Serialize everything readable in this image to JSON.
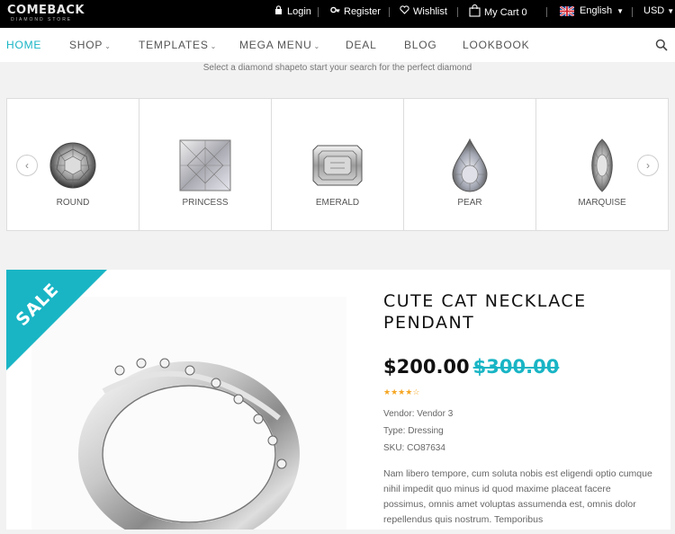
{
  "header": {
    "logo_text": "COMEBACK",
    "logo_sub": "DIAMOND STORE",
    "login_label": "Login",
    "register_label": "Register",
    "wishlist_label": "Wishlist",
    "cart_label": "My Cart 0",
    "language": "English",
    "currency": "USD"
  },
  "nav": {
    "items": [
      {
        "label": "HOME"
      },
      {
        "label": "SHOP"
      },
      {
        "label": "TEMPLATES"
      },
      {
        "label": "MEGA MENU"
      },
      {
        "label": "DEAL"
      },
      {
        "label": "BLOG"
      },
      {
        "label": "LOOKBOOK"
      }
    ]
  },
  "shapes": {
    "hint": "Select a diamond shapeto start your search for the perfect diamond",
    "items": [
      {
        "label": "ROUND"
      },
      {
        "label": "PRINCESS"
      },
      {
        "label": "EMERALD"
      },
      {
        "label": "PEAR"
      },
      {
        "label": "MARQUISE"
      }
    ]
  },
  "product": {
    "badge": "SALE",
    "title": "CUTE CAT NECKLACE PENDANT",
    "price": "$200.00",
    "compare_price": "$300.00",
    "rating": 4,
    "rating_max": 5,
    "vendor": "Vendor: Vendor 3",
    "type": "Type: Dressing",
    "sku": "SKU: CO87634",
    "description": "Nam libero tempore, cum soluta nobis est eligendi optio cumque nihil impedit quo minus id quod maxime placeat facere possimus, omnis amet voluptas assumenda est, omnis dolor repellendus quis nostrum. Temporibus"
  },
  "colors": {
    "accent": "#19b5c5",
    "topbar": "#000000",
    "star": "#f5a623"
  }
}
